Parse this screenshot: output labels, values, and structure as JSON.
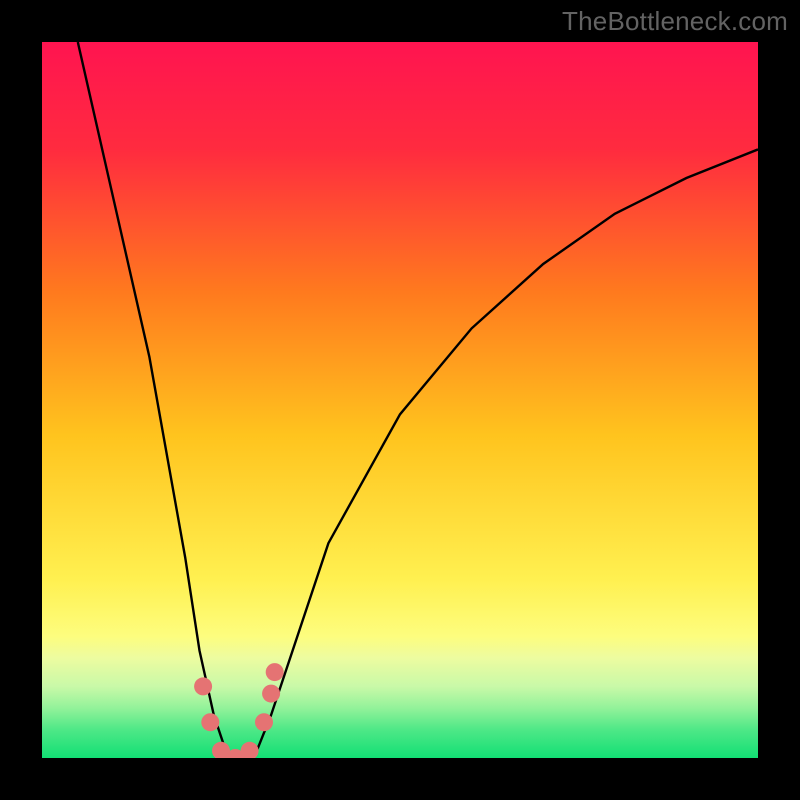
{
  "watermark": "TheBottleneck.com",
  "chart_data": {
    "type": "line",
    "title": "",
    "xlabel": "",
    "ylabel": "",
    "xlim": [
      0,
      100
    ],
    "ylim": [
      0,
      100
    ],
    "grid": false,
    "legend": false,
    "series": [
      {
        "name": "bottleneck-curve",
        "x": [
          5,
          10,
          15,
          20,
          22,
          24,
          26,
          28,
          30,
          32,
          35,
          40,
          50,
          60,
          70,
          80,
          90,
          100
        ],
        "y": [
          100,
          78,
          56,
          28,
          15,
          6,
          0,
          0,
          1,
          6,
          15,
          30,
          48,
          60,
          69,
          76,
          81,
          85
        ]
      }
    ],
    "markers": [
      {
        "x": 22.5,
        "y": 10
      },
      {
        "x": 23.5,
        "y": 5
      },
      {
        "x": 25.0,
        "y": 1
      },
      {
        "x": 27.0,
        "y": 0
      },
      {
        "x": 29.0,
        "y": 1
      },
      {
        "x": 31.0,
        "y": 5
      },
      {
        "x": 32.0,
        "y": 9
      },
      {
        "x": 32.5,
        "y": 12
      }
    ],
    "gradient_stops": [
      {
        "pos": 0.0,
        "color": "#ff1450"
      },
      {
        "pos": 0.15,
        "color": "#ff2b3f"
      },
      {
        "pos": 0.35,
        "color": "#ff7a1e"
      },
      {
        "pos": 0.55,
        "color": "#ffc41e"
      },
      {
        "pos": 0.75,
        "color": "#fff050"
      },
      {
        "pos": 0.83,
        "color": "#fdfd7e"
      },
      {
        "pos": 0.86,
        "color": "#edfca0"
      },
      {
        "pos": 0.9,
        "color": "#c9f9a8"
      },
      {
        "pos": 0.93,
        "color": "#93f29a"
      },
      {
        "pos": 0.96,
        "color": "#4fe887"
      },
      {
        "pos": 1.0,
        "color": "#12df74"
      }
    ],
    "marker_color": "#e57373",
    "curve_color": "#000000"
  }
}
